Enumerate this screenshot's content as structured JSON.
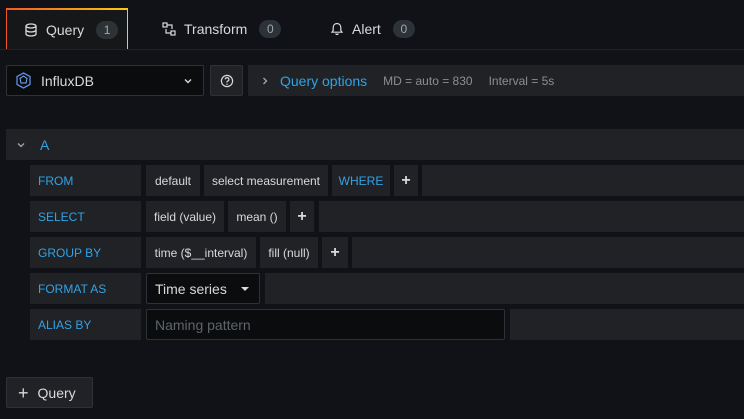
{
  "tabs": [
    {
      "label": "Query",
      "count": "1",
      "icon": "database-icon"
    },
    {
      "label": "Transform",
      "count": "0",
      "icon": "transform-icon"
    },
    {
      "label": "Alert",
      "count": "0",
      "icon": "bell-icon"
    }
  ],
  "datasource": {
    "name": "InfluxDB",
    "icon": "influxdb-logo-icon"
  },
  "query_options": {
    "title": "Query options",
    "md": "MD = auto = 830",
    "interval": "Interval = 5s"
  },
  "query": {
    "ref_id": "A",
    "from": {
      "label": "FROM",
      "policy": "default",
      "measurement": "select measurement",
      "where": "WHERE",
      "add": "+"
    },
    "select": {
      "label": "SELECT",
      "field": "field (value)",
      "func": "mean ()",
      "add": "+"
    },
    "group_by": {
      "label": "GROUP BY",
      "time": "time ($__interval)",
      "fill": "fill (null)",
      "add": "+"
    },
    "format_as": {
      "label": "FORMAT AS",
      "value": "Time series"
    },
    "alias_by": {
      "label": "ALIAS BY",
      "placeholder": "Naming pattern",
      "value": ""
    }
  },
  "add_query": {
    "label": "Query",
    "icon": "+"
  },
  "colors": {
    "accent": "#33a2e5",
    "panel": "#202226",
    "background": "#111217"
  }
}
